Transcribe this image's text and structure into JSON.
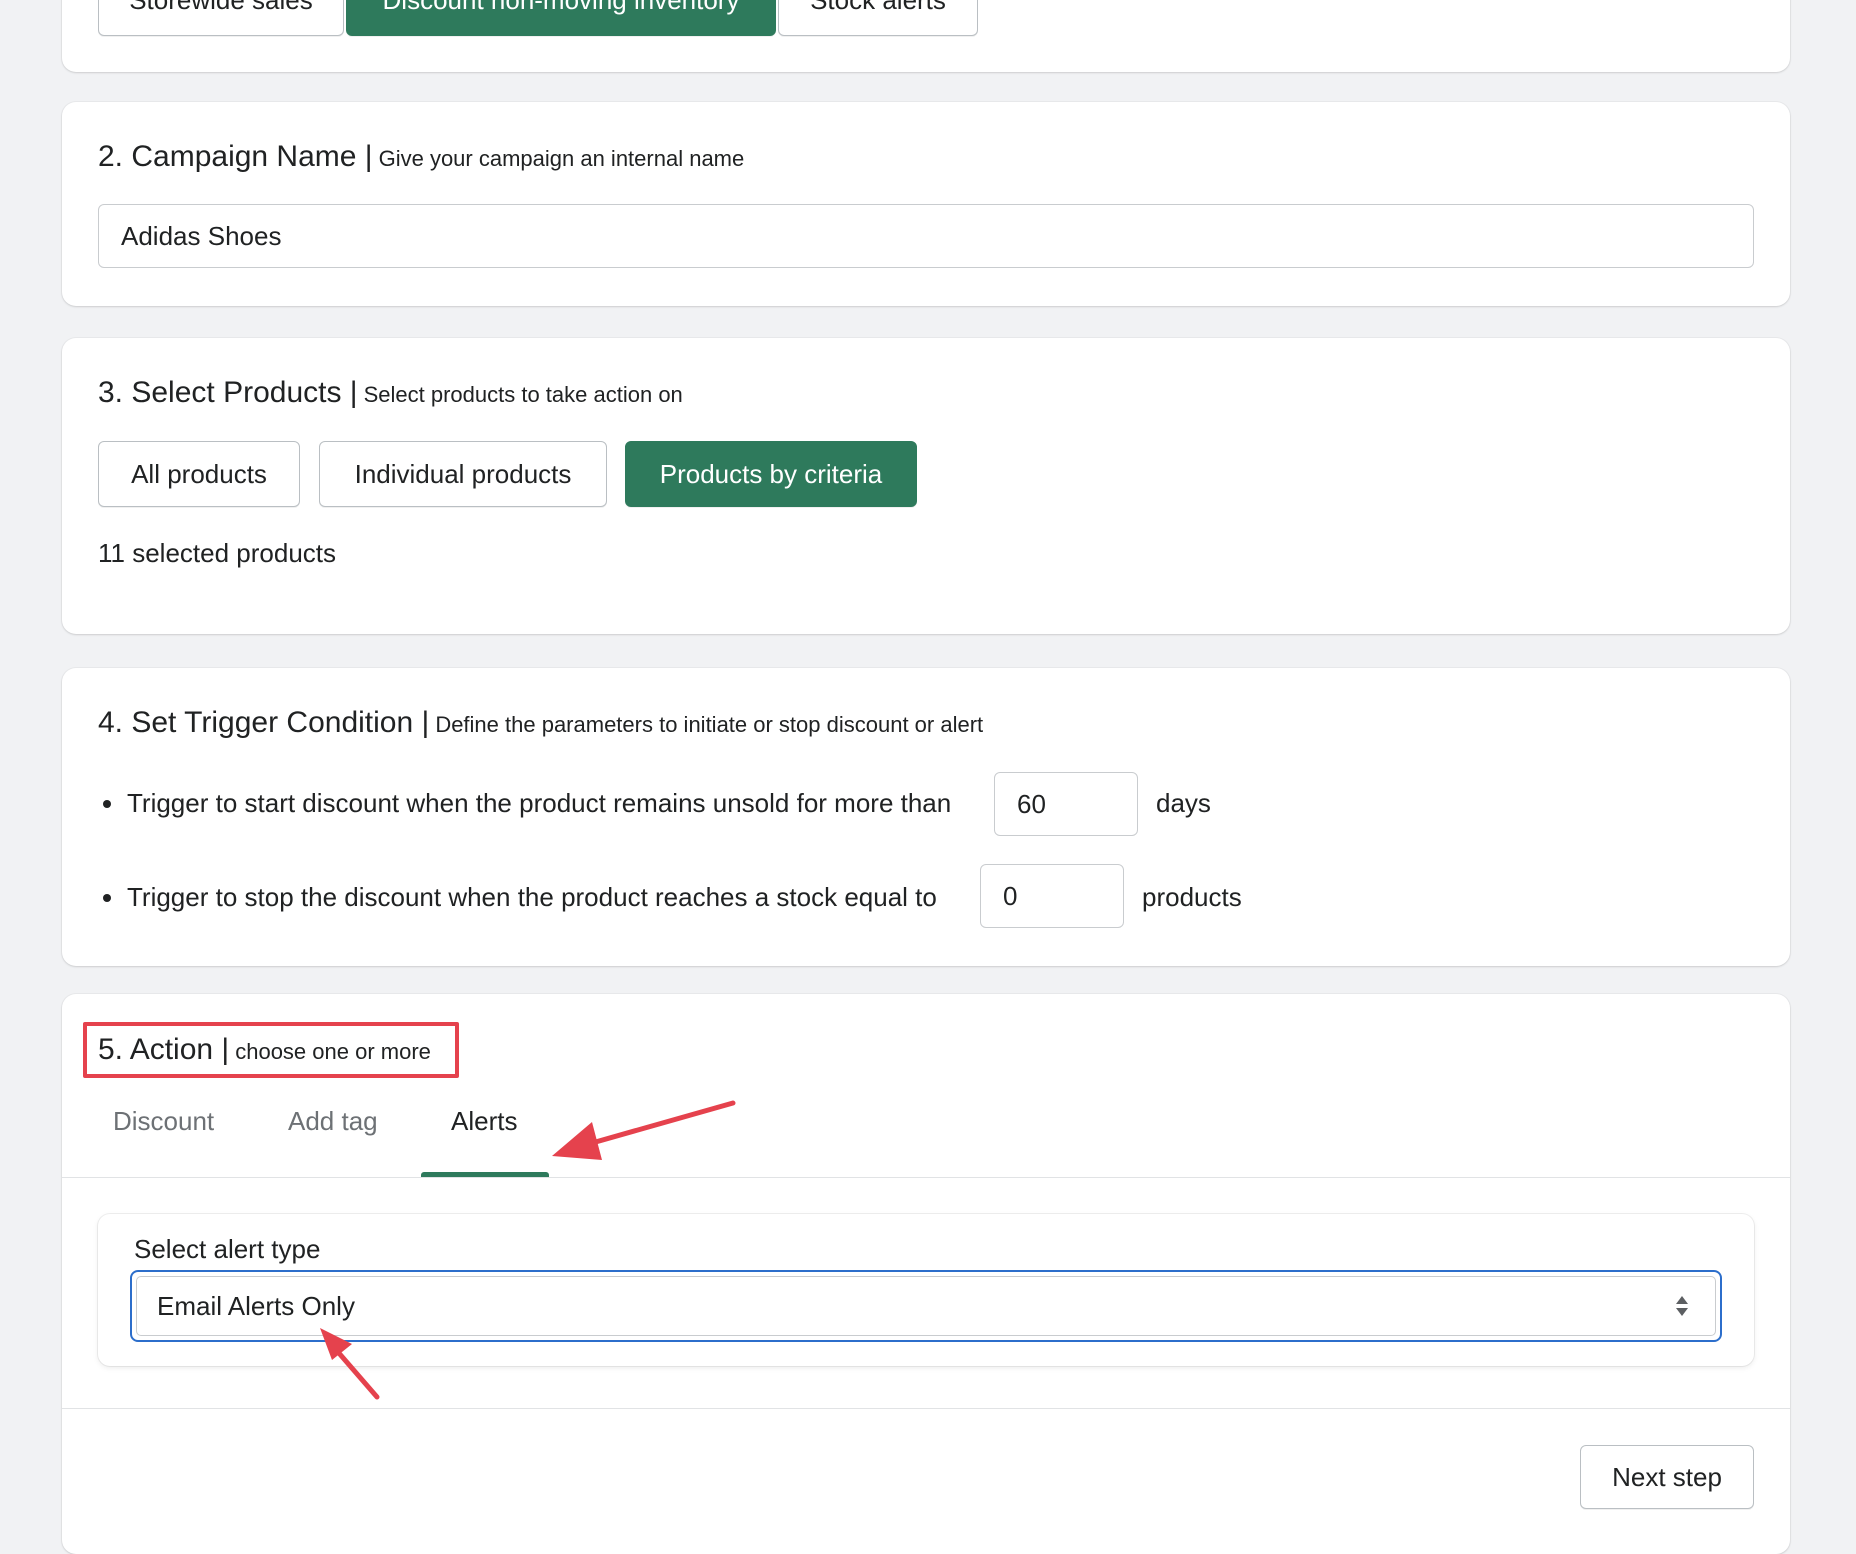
{
  "section1": {
    "buttons": [
      "Storewide sales",
      "Discount non-moving inventory",
      "Stock alerts"
    ],
    "active_index": 1
  },
  "section2": {
    "title": "2. Campaign Name |",
    "subtitle": "Give your campaign an internal name",
    "campaign_name_value": "Adidas Shoes"
  },
  "section3": {
    "title": "3. Select Products |",
    "subtitle": "Select products to take action on",
    "buttons": [
      "All products",
      "Individual products",
      "Products by criteria"
    ],
    "active_index": 2,
    "selected_count_text": "11 selected products"
  },
  "section4": {
    "title": "4. Set Trigger Condition |",
    "subtitle": "Define the parameters to initiate or stop discount or alert",
    "start_label": "Trigger to start discount when the product remains unsold for more than",
    "start_value": "60",
    "start_unit": "days",
    "stop_label": "Trigger to stop the discount when the product reaches a stock equal to",
    "stop_value": "0",
    "stop_unit": "products"
  },
  "section5": {
    "title": "5. Action |",
    "subtitle": "choose one or more",
    "tabs": [
      "Discount",
      "Add tag",
      "Alerts"
    ],
    "selected_tab_index": 2,
    "alert_type_label": "Select alert type",
    "alert_type_value": "Email Alerts Only",
    "next_button": "Next step"
  },
  "colors": {
    "primary_green": "#2e7a5c",
    "annotation_red": "#e5424d",
    "focus_blue": "#2c6ecb",
    "page_bg": "#f1f2f4"
  },
  "icons": {
    "select_chevron": "select-updown-icon",
    "annotation_arrow": "red-arrow-icon"
  }
}
